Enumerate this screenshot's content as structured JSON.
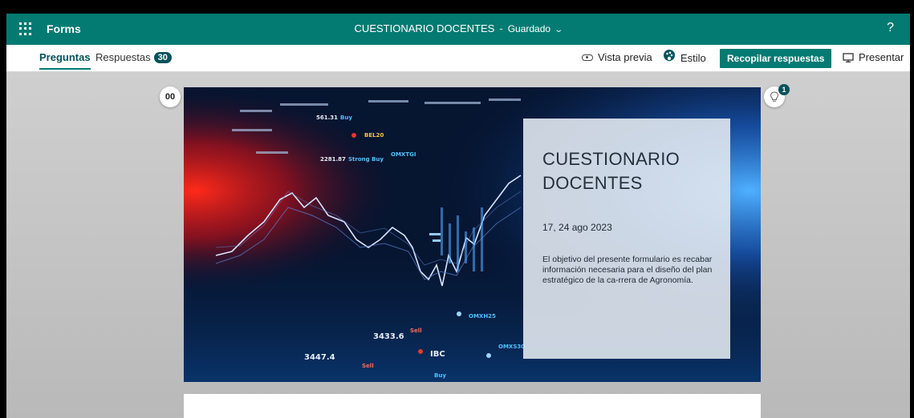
{
  "header": {
    "app_name": "Forms",
    "form_title": "CUESTIONARIO DOCENTES",
    "separator": "-",
    "save_status": "Guardado",
    "help": "?"
  },
  "toolbar": {
    "tab_questions": "Preguntas",
    "tab_responses": "Respuestas",
    "responses_count": "30",
    "preview": "Vista previa",
    "style": "Estilo",
    "collect": "Recopilar respuestas",
    "present": "Presentar"
  },
  "canvas": {
    "pause_label": "00",
    "idea_badge": "1"
  },
  "banner": {
    "ticker_texts": [
      "561.31",
      "Buy",
      "BEL20",
      "2281.87",
      "Strong Buy",
      "OMXTGI",
      "3433.6",
      "Sell",
      "OMXH25",
      "3447.4",
      "Sell",
      "IBC",
      "OMXS30",
      "Buy"
    ]
  },
  "card": {
    "title": "CUESTIONARIO DOCENTES",
    "date": "17, 24 ago 2023",
    "description": "El objetivo del presente formulario es recabar información necesaria para el diseño del plan estratégico de la ca-rrera de Agronomía."
  },
  "colors": {
    "accent": "#037b72",
    "dark_accent": "#03525b"
  }
}
